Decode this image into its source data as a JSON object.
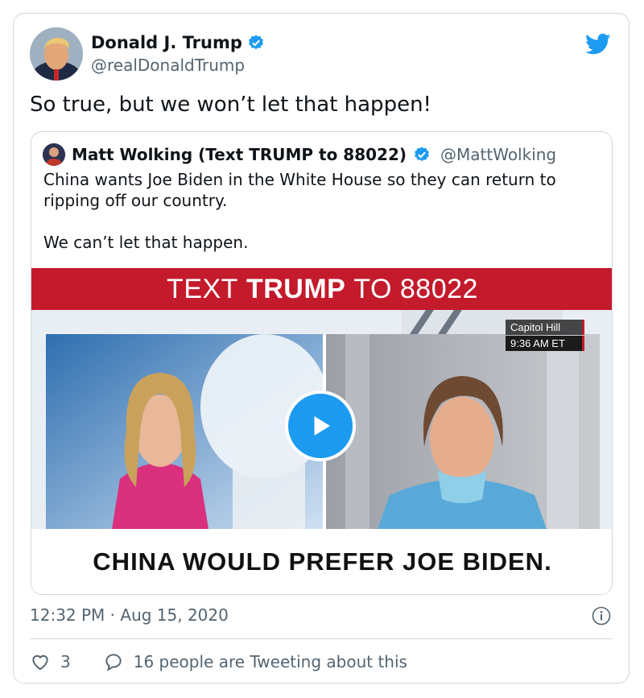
{
  "tweet": {
    "author_name": "Donald J. Trump",
    "author_handle": "@realDonaldTrump",
    "text": "So true, but we won’t let that happen!",
    "timestamp": "12:32 PM · Aug 15, 2020",
    "likes": "3",
    "conversation_text": "16 people are Tweeting about this"
  },
  "quote": {
    "author_name": "Matt Wolking (Text TRUMP to 88022)",
    "author_handle": "@MattWolking",
    "text_line1": "China wants Joe Biden in the White House so they can return to ripping off our country.",
    "text_line2": "We can’t let that happen.",
    "media": {
      "banner_prefix": "TEXT",
      "banner_bold": "TRUMP",
      "banner_suffix": "TO 88022",
      "location": "Capitol Hill",
      "time": "9:36 AM ET",
      "caption": "CHINA WOULD PREFER JOE BIDEN."
    }
  },
  "icons": {
    "verified": "verified-badge-icon",
    "brand": "twitter-bird-icon",
    "play": "play-icon",
    "info": "info-icon",
    "like": "heart-icon",
    "reply": "speech-bubble-icon"
  },
  "colors": {
    "accent": "#1d9bf0",
    "banner": "#c31a2c",
    "secondary_text": "#536471",
    "border": "#cfd9de"
  }
}
